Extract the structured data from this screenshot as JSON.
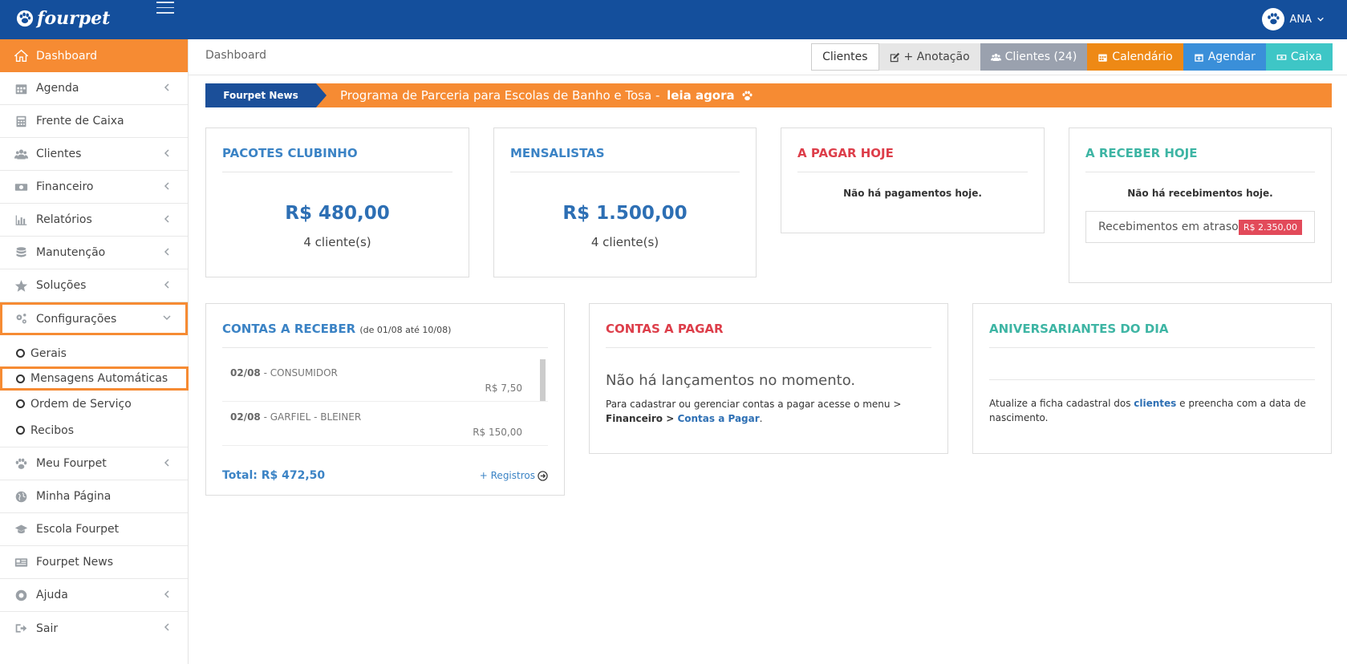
{
  "app": {
    "brand": "fourpet",
    "user": "ANA"
  },
  "sidebar": {
    "items": [
      {
        "label": "Dashboard",
        "icon": "home-icon"
      },
      {
        "label": "Agenda",
        "icon": "calendar-icon"
      },
      {
        "label": "Frente de Caixa",
        "icon": "calculator-icon"
      },
      {
        "label": "Clientes",
        "icon": "users-icon"
      },
      {
        "label": "Financeiro",
        "icon": "money-icon"
      },
      {
        "label": "Relatórios",
        "icon": "bar-chart-icon"
      },
      {
        "label": "Manutenção",
        "icon": "database-icon"
      },
      {
        "label": "Soluções",
        "icon": "star-icon"
      },
      {
        "label": "Configurações",
        "icon": "gears-icon"
      }
    ],
    "config_sub": [
      "Gerais",
      "Mensagens Automáticas",
      "Ordem de Serviço",
      "Recibos"
    ],
    "items_bottom": [
      {
        "label": "Meu Fourpet",
        "icon": "paw-icon"
      },
      {
        "label": "Minha Página",
        "icon": "globe-icon"
      },
      {
        "label": "Escola Fourpet",
        "icon": "graduation-cap-icon"
      },
      {
        "label": "Fourpet News",
        "icon": "newspaper-icon"
      },
      {
        "label": "Ajuda",
        "icon": "help-icon"
      },
      {
        "label": "Sair",
        "icon": "sign-out-icon"
      }
    ]
  },
  "header": {
    "breadcrumb": "Dashboard",
    "buttons": {
      "clientes": "Clientes",
      "anotacao": "+ Anotação",
      "clientes_count": "Clientes (24)",
      "calendario": "Calendário",
      "agendar": "Agendar",
      "caixa": "Caixa"
    }
  },
  "news": {
    "tag": "Fourpet News",
    "text": "Programa de Parceria para Escolas de Banho e Tosa - ",
    "cta": "leia agora"
  },
  "cards": {
    "clubinho": {
      "title": "PACOTES CLUBINHO",
      "value": "R$ 480,00",
      "sub": "4 cliente(s)"
    },
    "mensalistas": {
      "title": "MENSALISTAS",
      "value": "R$ 1.500,00",
      "sub": "4 cliente(s)"
    },
    "pagar_hoje": {
      "title": "A PAGAR HOJE",
      "message": "Não há pagamentos hoje."
    },
    "receber_hoje": {
      "title": "A RECEBER HOJE",
      "message": "Não há recebimentos hoje.",
      "late_label": "Recebimentos em atraso",
      "late_value": "R$ 2.350,00"
    },
    "contas_receber": {
      "title": "CONTAS A RECEBER",
      "range": "(de 01/08 até 10/08)",
      "rows": [
        {
          "date": "02/08",
          "name": " - CONSUMIDOR",
          "amount": "R$ 7,50"
        },
        {
          "date": "02/08",
          "name": " - GARFIEL - BLEINER",
          "amount": "R$ 150,00"
        }
      ],
      "total": "Total: R$ 472,50",
      "more": "+ Registros"
    },
    "contas_pagar": {
      "title": "CONTAS A PAGAR",
      "empty": "Não há lançamentos no momento.",
      "desc": "Para cadastrar ou gerenciar contas a pagar acesse o menu > ",
      "menu": "Financeiro",
      "sep": " > ",
      "link": "Contas a Pagar",
      "end": "."
    },
    "aniversariantes": {
      "title": "ANIVERSARIANTES DO DIA",
      "desc1": "Atualize a ficha cadastral dos ",
      "link": "clientes",
      "desc2": " e preencha com a data de nascimento."
    }
  },
  "colors": {
    "topbar": "#144f9c",
    "accent": "#f68b33",
    "blue": "#3b83c5",
    "red": "#dd3e4a",
    "teal": "#3eb5a4"
  }
}
